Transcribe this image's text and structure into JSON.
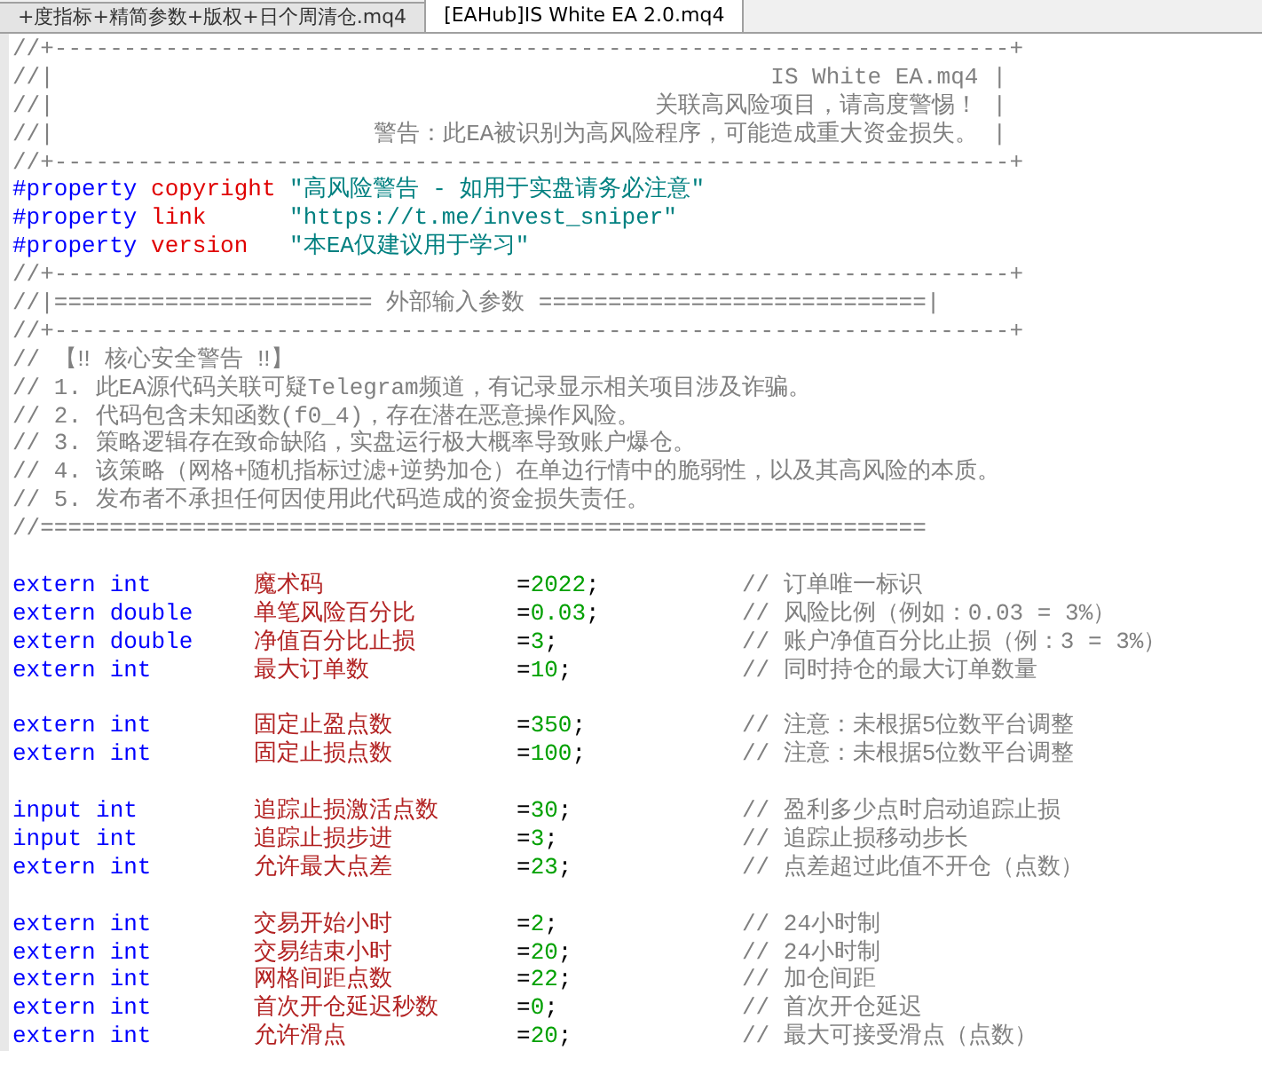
{
  "tabs": [
    {
      "label": "+度指标+精简参数+版权+日个周清仓.mq4",
      "selected": false
    },
    {
      "label": "[EAHub]IS White EA 2.0.mq4",
      "selected": true
    }
  ],
  "lines": [
    {
      "kind": "comment",
      "text": "//+---------------------------------------------------------------------+"
    },
    {
      "kind": "box",
      "prefix": "//|",
      "text": "IS White EA.mq4",
      "suffix": "|"
    },
    {
      "kind": "box",
      "prefix": "//|",
      "text": "关联高风险项目，请高度警惕！",
      "suffix": "|"
    },
    {
      "kind": "box",
      "prefix": "//|",
      "text": "警告：此EA被识别为高风险程序，可能造成重大资金损失。",
      "suffix": "|"
    },
    {
      "kind": "comment",
      "text": "//+---------------------------------------------------------------------+"
    },
    {
      "kind": "property",
      "directive": "#property",
      "key": "copyright",
      "value": "\"高风险警告 - 如用于实盘请务必注意\""
    },
    {
      "kind": "property",
      "directive": "#property",
      "key": "link",
      "value": "\"https://t.me/invest_sniper\""
    },
    {
      "kind": "property",
      "directive": "#property",
      "key": "version",
      "value": "\"本EA仅建议用于学习\""
    },
    {
      "kind": "comment",
      "text": "//+---------------------------------------------------------------------+"
    },
    {
      "kind": "comment",
      "text": "//|======================= 外部输入参数 ============================|"
    },
    {
      "kind": "comment",
      "text": "//+---------------------------------------------------------------------+"
    },
    {
      "kind": "comment",
      "text": "// 【‼ 核心安全警告 ‼】"
    },
    {
      "kind": "comment",
      "text": "// 1. 此EA源代码关联可疑Telegram频道，有记录显示相关项目涉及诈骗。"
    },
    {
      "kind": "comment",
      "text": "// 2. 代码包含未知函数(f0_4)，存在潜在恶意操作风险。"
    },
    {
      "kind": "comment",
      "text": "// 3. 策略逻辑存在致命缺陷，实盘运行极大概率导致账户爆仓。"
    },
    {
      "kind": "comment",
      "text": "// 4. 该策略（网格+随机指标过滤+逆势加仓）在单边行情中的脆弱性，以及其高风险的本质。"
    },
    {
      "kind": "comment",
      "text": "// 5. 发布者不承担任何因使用此代码造成的资金损失责任。"
    },
    {
      "kind": "comment",
      "text": "//================================================================"
    },
    {
      "kind": "blank"
    },
    {
      "kind": "decl",
      "modifier": "extern",
      "type": "int",
      "name": "魔术码",
      "op": "=",
      "value": "2022",
      "end": ";",
      "comment": "// 订单唯一标识"
    },
    {
      "kind": "decl",
      "modifier": "extern",
      "type": "double",
      "name": "单笔风险百分比",
      "op": "=",
      "value": "0.03",
      "end": ";",
      "comment": "// 风险比例（例如：0.03 = 3%）"
    },
    {
      "kind": "decl",
      "modifier": "extern",
      "type": "double",
      "name": "净值百分比止损",
      "op": "=",
      "value": "3",
      "end": ";",
      "comment": "// 账户净值百分比止损（例：3 = 3%）"
    },
    {
      "kind": "decl",
      "modifier": "extern",
      "type": "int",
      "name": "最大订单数",
      "op": "=",
      "value": "10",
      "end": ";",
      "comment": "// 同时持仓的最大订单数量"
    },
    {
      "kind": "blank"
    },
    {
      "kind": "decl",
      "modifier": "extern",
      "type": "int",
      "name": "固定止盈点数",
      "op": "=",
      "value": "350",
      "end": ";",
      "comment": "// 注意：未根据5位数平台调整"
    },
    {
      "kind": "decl",
      "modifier": "extern",
      "type": "int",
      "name": "固定止损点数",
      "op": "=",
      "value": "100",
      "end": ";",
      "comment": "// 注意：未根据5位数平台调整"
    },
    {
      "kind": "blank"
    },
    {
      "kind": "decl",
      "modifier": "input",
      "type": "int",
      "name": "追踪止损激活点数",
      "op": "=",
      "value": "30",
      "end": ";",
      "comment": "// 盈利多少点时启动追踪止损"
    },
    {
      "kind": "decl",
      "modifier": "input",
      "type": "int",
      "name": "追踪止损步进",
      "op": "=",
      "value": "3",
      "end": ";",
      "comment": "// 追踪止损移动步长"
    },
    {
      "kind": "decl",
      "modifier": "extern",
      "type": "int",
      "name": "允许最大点差",
      "op": "=",
      "value": "23",
      "end": ";",
      "comment": "// 点差超过此值不开仓（点数）"
    },
    {
      "kind": "blank"
    },
    {
      "kind": "decl",
      "modifier": "extern",
      "type": "int",
      "name": "交易开始小时",
      "op": "=",
      "value": "2",
      "end": ";",
      "comment": "// 24小时制"
    },
    {
      "kind": "decl",
      "modifier": "extern",
      "type": "int",
      "name": "交易结束小时",
      "op": "=",
      "value": "20",
      "end": ";",
      "comment": "// 24小时制"
    },
    {
      "kind": "decl",
      "modifier": "extern",
      "type": "int",
      "name": "网格间距点数",
      "op": "=",
      "value": "22",
      "end": ";",
      "comment": "// 加仓间距"
    },
    {
      "kind": "decl",
      "modifier": "extern",
      "type": "int",
      "name": "首次开仓延迟秒数",
      "op": "=",
      "value": "0",
      "end": ";",
      "comment": "// 首次开仓延迟"
    },
    {
      "kind": "decl",
      "modifier": "extern",
      "type": "int",
      "name": "允许滑点",
      "op": "=",
      "value": "20",
      "end": ";",
      "comment": "// 最大可接受滑点（点数）"
    }
  ]
}
